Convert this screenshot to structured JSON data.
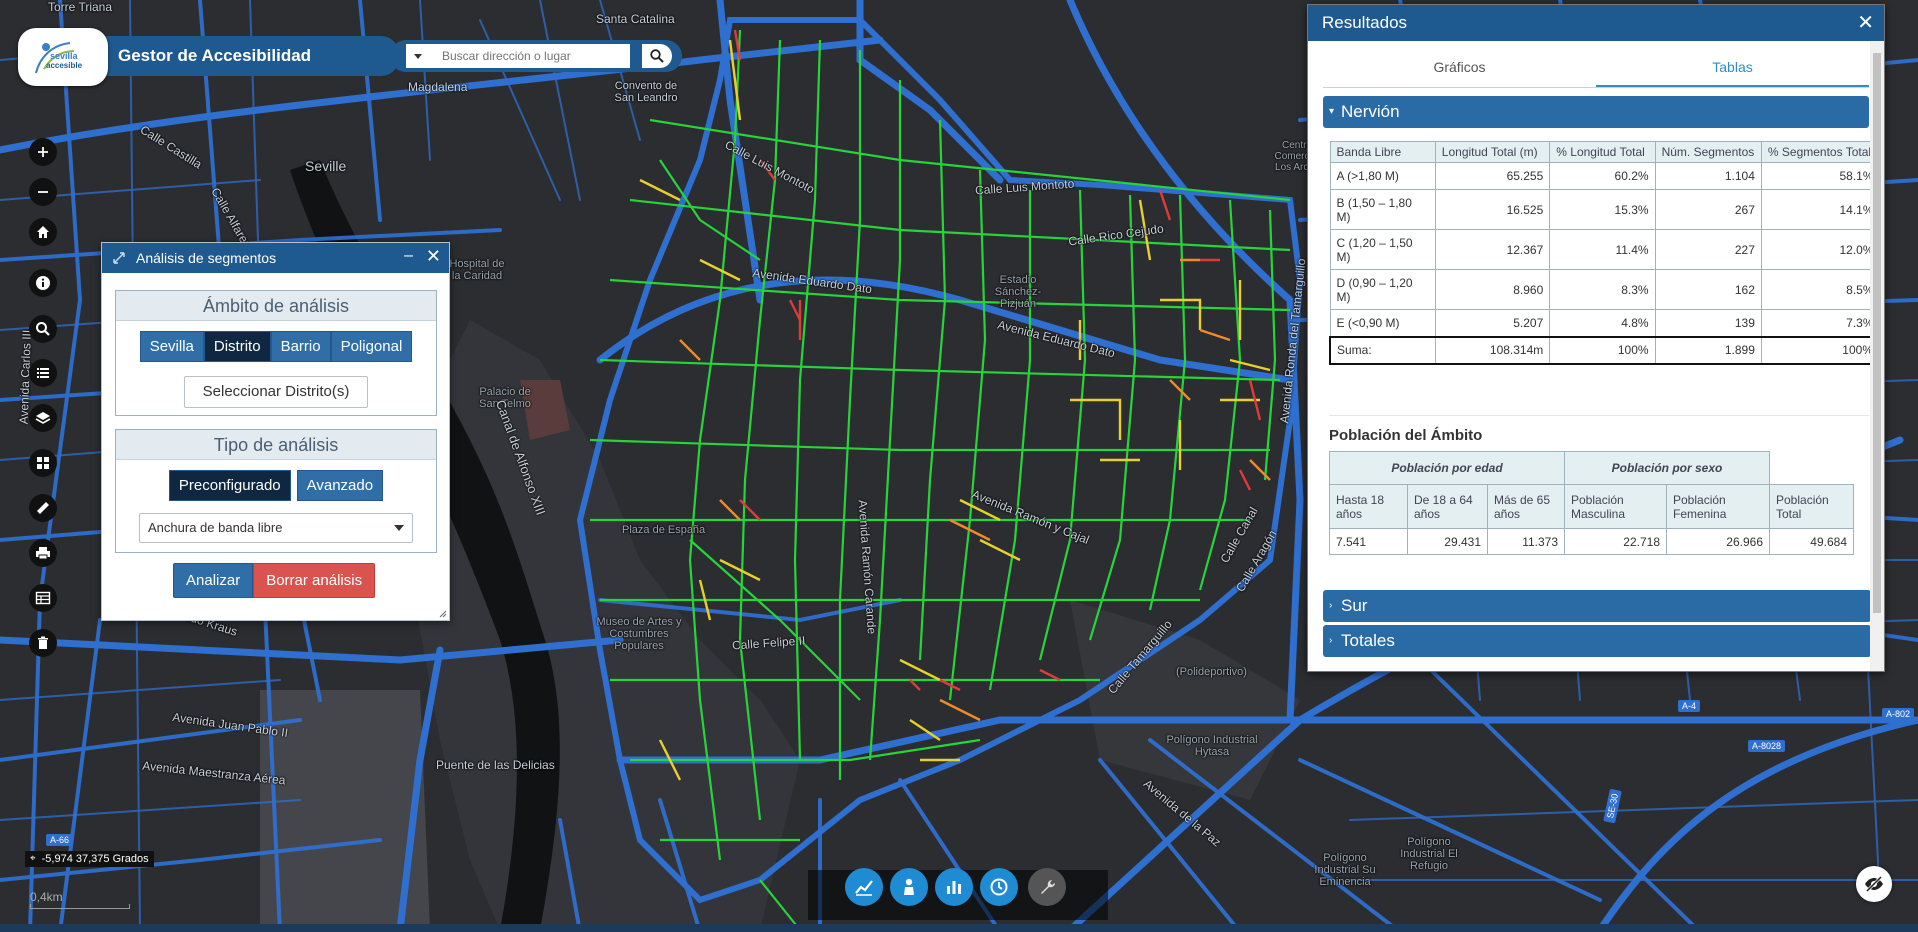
{
  "app": {
    "title": "Gestor de Accesibilidad",
    "logo_text": "sevilla accesible"
  },
  "search": {
    "placeholder": "Buscar dirección o lugar"
  },
  "left_toolbar": [
    {
      "name": "zoom-in-icon"
    },
    {
      "name": "zoom-out-icon"
    },
    {
      "name": "home-icon"
    },
    {
      "name": "info-icon"
    },
    {
      "name": "search-icon"
    },
    {
      "name": "list-icon"
    },
    {
      "name": "layers-icon"
    },
    {
      "name": "grid-icon"
    },
    {
      "name": "ruler-icon"
    },
    {
      "name": "print-icon"
    },
    {
      "name": "table-icon"
    },
    {
      "name": "trash-icon"
    }
  ],
  "map_labels": {
    "seville": "Seville",
    "torre_triana": "Torre Triana",
    "santa_catalina": "Santa Catalina",
    "magdalena": "Magdalena",
    "convento": "Convento de San Leandro",
    "calle_castilla": "Calle Castilla",
    "calle_alfarer": "Calle Alfarer",
    "calle_luis_montoto_1": "Calle Luis Montoto",
    "calle_luis_montoto_2": "Calle Luis Montoto",
    "calle_rico_cejudo": "Calle Rico Cejudo",
    "avenida_eduardo_dato_1": "Avenida Eduardo Dato",
    "avenida_eduardo_dato_2": "Avenida Eduardo Dato",
    "estadio": "Estadio Sánchez-Pizjuán",
    "hospital": "Hospital de la Caridad",
    "palacio": "Palacio de San Telmo",
    "plaza_espana": "Plaza de España",
    "museo_artes": "Museo de Artes y Costumbres Populares",
    "canal_alfonso": "Canal de Alfonso XIII",
    "avenida_ramon_carande": "Avenida Ramón Carande",
    "avenida_ramon_y_cajal": "Avenida Ramón y Cajal",
    "calle_felipe": "Calle Felipe II",
    "alfredo_kraus": "Alfredo Kraus",
    "avenida_juan_pablo": "Avenida Juan Pablo II",
    "avenida_maestranza": "Avenida Maestranza Aérea",
    "puente_delicias": "Puente de las Delicias",
    "calle_tamarguillo": "Calle Tamarguillo",
    "avenida_la_paz": "Avenida de la Paz",
    "calle_puerta": "Calle Puerta",
    "poligono_hytasa": "Polígono Industrial Hytasa",
    "polideportivo": "(Polideportivo)",
    "poligono_su_eminencia": "Polígono Industrial Su Eminencia",
    "poligono_el_refugio": "Polígono Industrial El Refugio",
    "avenida_carlos": "Avenida Carlos III",
    "centro_comercial": "Centro Comercial Los Arcos",
    "avenida_kansas": "Avenida Kansas City",
    "calle_canal": "Calle Canal",
    "calle_aragon": "Calle Aragón",
    "avenida_ronda": "Avenida Ronda del Tamarguillo",
    "a4": "A-4",
    "a8028": "A-8028",
    "a802": "A-802",
    "a66": "A-66",
    "se30": "SE-30"
  },
  "analysis_panel": {
    "title": "Análisis de segmentos",
    "scope_header": "Ámbito de análisis",
    "scope_buttons": [
      "Sevilla",
      "Distrito",
      "Barrio",
      "Poligonal"
    ],
    "scope_active": "Distrito",
    "select_button": "Seleccionar Distrito(s)",
    "type_header": "Tipo de análisis",
    "type_buttons": [
      "Preconfigurado",
      "Avanzado"
    ],
    "type_active": "Preconfigurado",
    "dropdown_value": "Anchura de banda libre",
    "analyze_button": "Analizar",
    "clear_button": "Borrar análisis"
  },
  "results_panel": {
    "title": "Resultados",
    "tabs": [
      "Gráficos",
      "Tablas"
    ],
    "active_tab": "Tablas",
    "district": "Nervión",
    "band_table": {
      "headers": [
        "Banda Libre",
        "Longitud Total (m)",
        "% Longitud Total",
        "Núm. Segmentos",
        "% Segmentos Total"
      ],
      "rows": [
        [
          "A (>1,80 M)",
          "65.255",
          "60.2%",
          "1.104",
          "58.1%"
        ],
        [
          "B (1,50 – 1,80 M)",
          "16.525",
          "15.3%",
          "267",
          "14.1%"
        ],
        [
          "C (1,20 – 1,50 M)",
          "12.367",
          "11.4%",
          "227",
          "12.0%"
        ],
        [
          "D (0,90 – 1,20 M)",
          "8.960",
          "8.3%",
          "162",
          "8.5%"
        ],
        [
          "E (<0,90 M)",
          "5.207",
          "4.8%",
          "139",
          "7.3%"
        ]
      ],
      "sum_row": [
        "Suma:",
        "108.314m",
        "100%",
        "1.899",
        "100%"
      ]
    },
    "population": {
      "title": "Población del Ámbito",
      "group_age": "Población por edad",
      "group_sex": "Población por sexo",
      "headers": [
        "Hasta 18 años",
        "De 18 a 64 años",
        "Más de 65 años",
        "Población Masculina",
        "Población Femenina",
        "Población Total"
      ],
      "values": [
        "7.541",
        "29.431",
        "11.373",
        "22.718",
        "26.966",
        "49.684"
      ]
    },
    "collapsed_sections": [
      "Sur",
      "Totales"
    ]
  },
  "status": {
    "coordinates": "-5,974 37,375 Grados",
    "scale": "0,4km"
  },
  "bottom_toolbar": [
    {
      "name": "line-chart-icon"
    },
    {
      "name": "person-icon"
    },
    {
      "name": "bar-chart-icon"
    },
    {
      "name": "clock-icon"
    },
    {
      "name": "wrench-icon"
    }
  ],
  "colors": {
    "brand": "#1e5a8f",
    "accent": "#2a6aa5",
    "danger": "#d9534f",
    "segment_good": "#22cc33",
    "segment_mid": "#e6d030",
    "segment_bad": "#e03a3a",
    "road": "#2f6fcf"
  }
}
